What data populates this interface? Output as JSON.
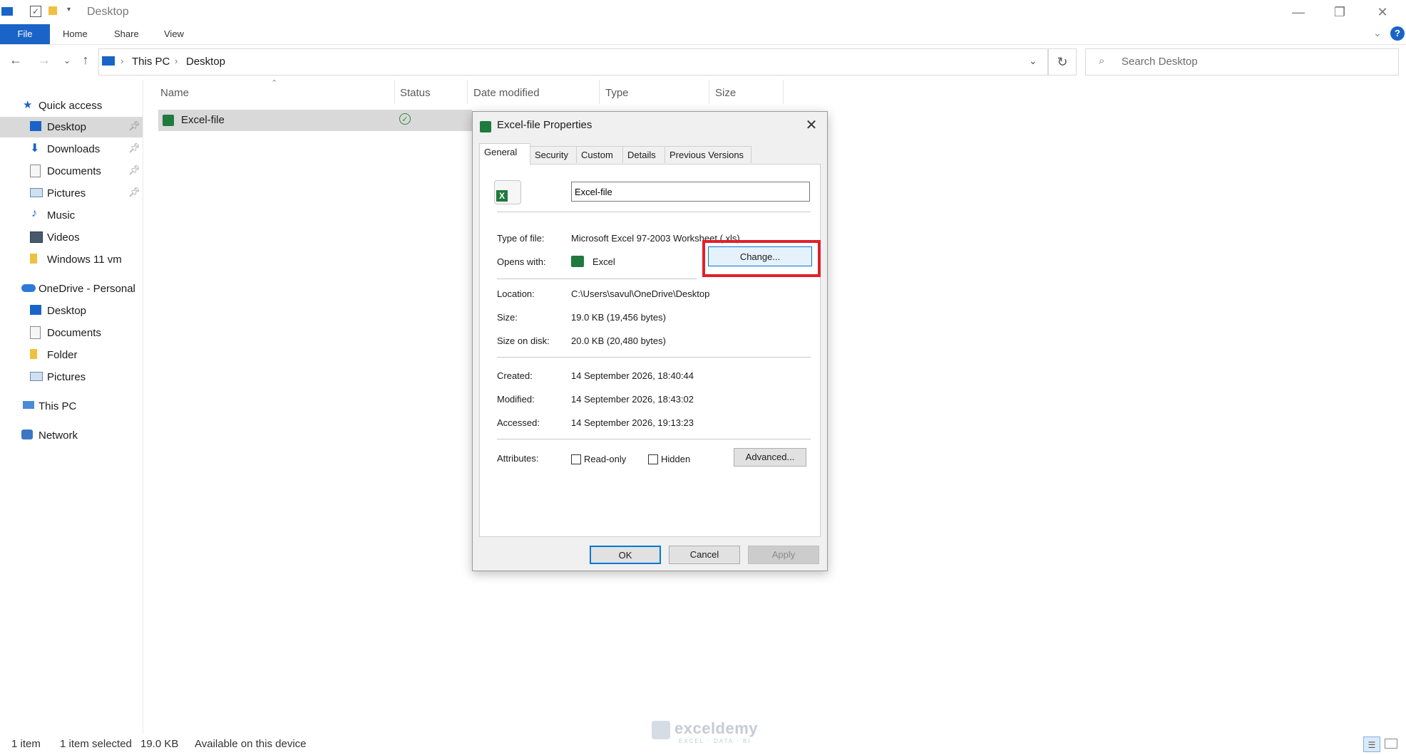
{
  "window": {
    "title": "Desktop",
    "minimize": "—",
    "maximize": "❐",
    "close": "✕",
    "help": "?"
  },
  "ribbon": {
    "tabs": [
      "File",
      "Home",
      "Share",
      "View"
    ]
  },
  "address": {
    "crumbs": [
      "This PC",
      "Desktop"
    ],
    "search_placeholder": "Search Desktop"
  },
  "sidebar": {
    "quick_access": "Quick access",
    "quick_items": [
      "Desktop",
      "Downloads",
      "Documents",
      "Pictures",
      "Music",
      "Videos",
      "Windows 11 vm"
    ],
    "onedrive": "OneDrive - Personal",
    "onedrive_items": [
      "Desktop",
      "Documents",
      "Folder",
      "Pictures"
    ],
    "this_pc": "This PC",
    "network": "Network"
  },
  "file_list": {
    "columns": [
      "Name",
      "Status",
      "Date modified",
      "Type",
      "Size"
    ],
    "file_name": "Excel-file"
  },
  "status_bar": {
    "item_count": "1 item",
    "selected": "1 item selected",
    "selected_size": "19.0 KB",
    "availability": "Available on this device"
  },
  "dialog": {
    "title": "Excel-file Properties",
    "tabs": [
      "General",
      "Security",
      "Custom",
      "Details",
      "Previous Versions"
    ],
    "filename": "Excel-file",
    "labels": {
      "type": "Type of file:",
      "opens": "Opens with:",
      "location": "Location:",
      "size": "Size:",
      "size_on_disk": "Size on disk:",
      "created": "Created:",
      "modified": "Modified:",
      "accessed": "Accessed:",
      "attributes": "Attributes:"
    },
    "values": {
      "type": "Microsoft Excel 97-2003 Worksheet (.xls)",
      "opens": "Excel",
      "location": "C:\\Users\\savul\\OneDrive\\Desktop",
      "size": "19.0 KB (19,456 bytes)",
      "size_on_disk": "20.0 KB (20,480 bytes)",
      "created": "14 September 2026, 18:40:44",
      "modified": "14 September 2026, 18:43:02",
      "accessed": "14 September 2026, 19:13:23"
    },
    "buttons": {
      "change": "Change...",
      "advanced": "Advanced...",
      "ok": "OK",
      "cancel": "Cancel",
      "apply": "Apply"
    },
    "checkboxes": {
      "readonly": "Read-only",
      "hidden": "Hidden"
    }
  },
  "watermark": {
    "brand": "exceldemy",
    "tagline": "EXCEL · DATA · BI"
  },
  "colors": {
    "accent": "#1a64c8",
    "highlight": "#e0202a",
    "excel_green": "#1f7a3e"
  }
}
